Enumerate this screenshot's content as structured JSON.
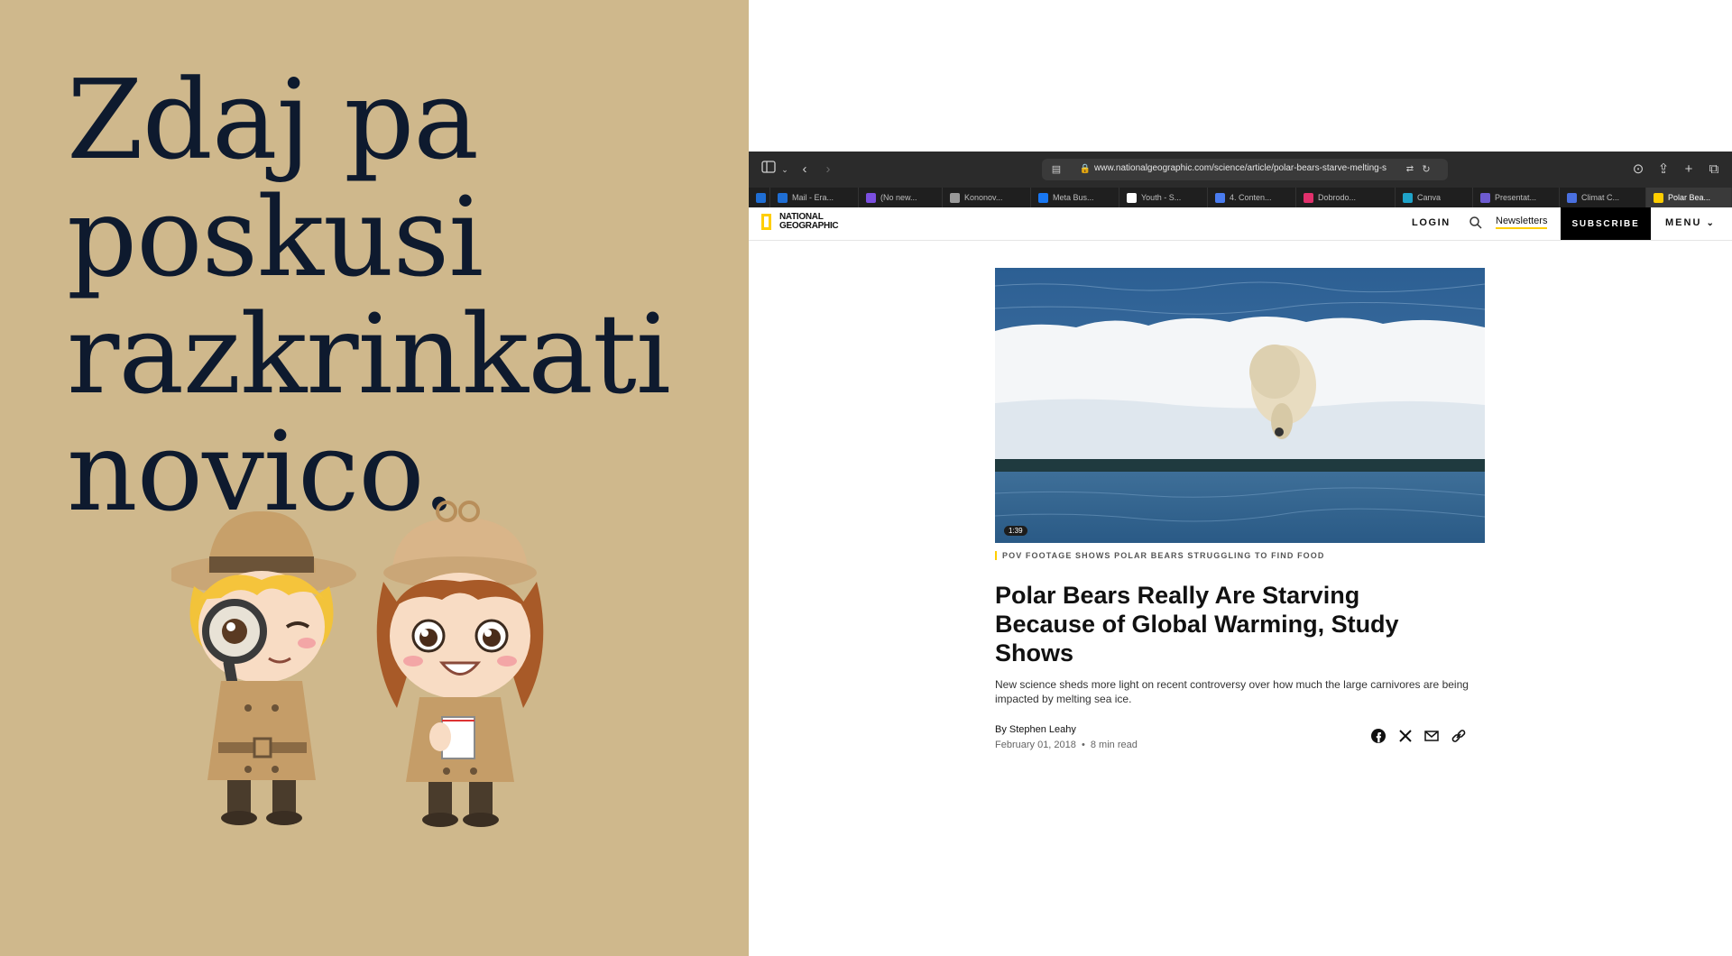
{
  "slide": {
    "title_lines": [
      "Zdaj pa",
      "poskusi",
      "razkrinkati",
      "novico."
    ]
  },
  "browser": {
    "url": "www.nationalgeographic.com/science/article/polar-bears-starve-melting-s",
    "tabs": [
      {
        "label": "",
        "icon": "outlook-icon",
        "color": "#1f6ed4"
      },
      {
        "label": "Mail - Era...",
        "icon": "outlook-icon",
        "color": "#1f6ed4"
      },
      {
        "label": "(No new...",
        "icon": "mail-icon",
        "color": "#7b4fe0"
      },
      {
        "label": "Kononov...",
        "icon": "ok-icon",
        "color": "#9a9a9a"
      },
      {
        "label": "Meta Bus...",
        "icon": "facebook-icon",
        "color": "#1877f2"
      },
      {
        "label": "Youth - S...",
        "icon": "google-icon",
        "color": "#ffffff"
      },
      {
        "label": "4. Conten...",
        "icon": "docs-icon",
        "color": "#4a7cf0"
      },
      {
        "label": "Dobrodo...",
        "icon": "instagram-icon",
        "color": "#e1306c"
      },
      {
        "label": "Canva",
        "icon": "canva-icon",
        "color": "#1fa3c9"
      },
      {
        "label": "Presentat...",
        "icon": "shield-icon",
        "color": "#6d5bd0"
      },
      {
        "label": "Climat C...",
        "icon": "shield-icon",
        "color": "#4a70e0"
      },
      {
        "label": "Polar Bea...",
        "icon": "natgeo-icon",
        "color": "#ffce00"
      }
    ]
  },
  "site": {
    "logo_line1": "NATIONAL",
    "logo_line2": "GEOGRAPHIC",
    "login": "LOGIN",
    "newsletters": "Newsletters",
    "subscribe": "SUBSCRIBE",
    "menu": "MENU"
  },
  "article": {
    "video_duration": "1:39",
    "caption": "POV FOOTAGE SHOWS POLAR BEARS STRUGGLING TO FIND FOOD",
    "headline": "Polar Bears Really Are Starving Because of Global Warming, Study Shows",
    "dek": "New science sheds more light on recent controversy over how much the large carnivores are being impacted by melting sea ice.",
    "byline": "By Stephen Leahy",
    "date": "February 01, 2018",
    "separator": "•",
    "read_time": "8 min read"
  },
  "colors": {
    "slide_background": "#cfb88c",
    "title_color": "#0e1a2e",
    "natgeo_yellow": "#ffce00"
  }
}
